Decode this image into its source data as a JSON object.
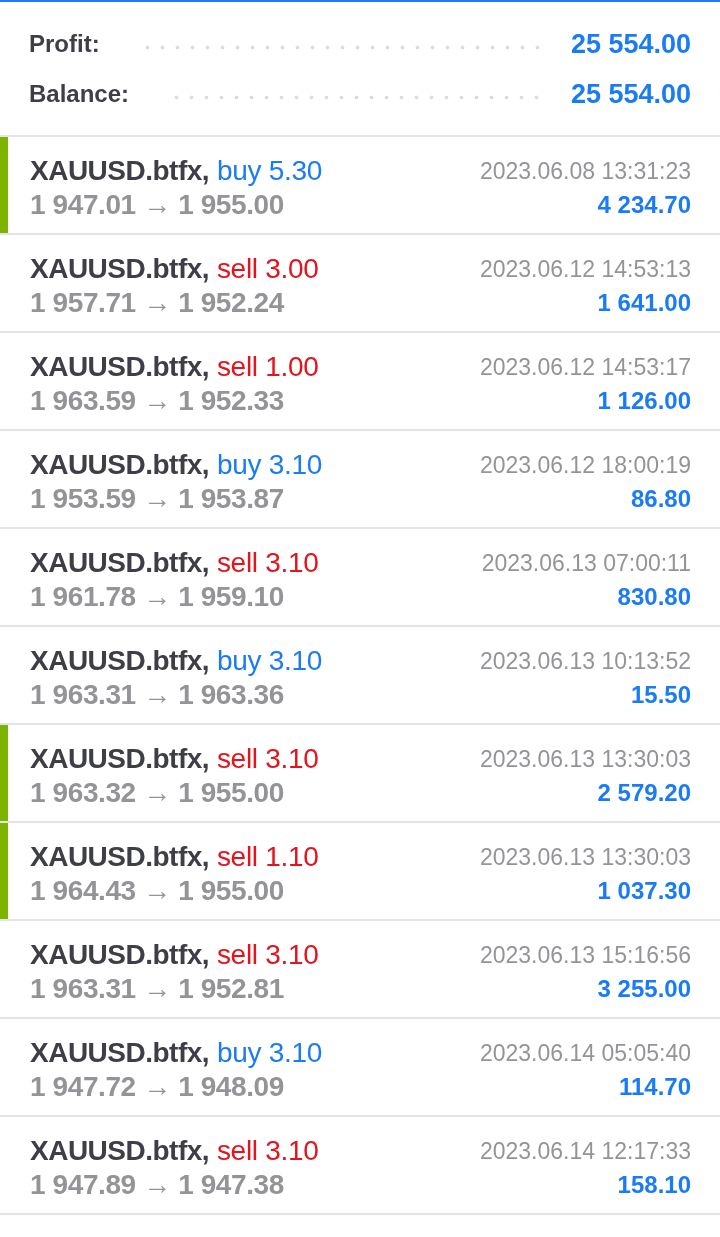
{
  "summary": [
    {
      "label": "Profit:",
      "value": "25 554.00"
    },
    {
      "label": "Balance:",
      "value": "25 554.00"
    }
  ],
  "trades": [
    {
      "symbol": "XAUUSD.btfx,",
      "order": {
        "kind": "buy",
        "text": "buy 5.30"
      },
      "prices": "1 947.01 → 1 955.00",
      "time": "2023.06.08 13:31:23",
      "profit": "4 234.70",
      "highlighted": true
    },
    {
      "symbol": "XAUUSD.btfx,",
      "order": {
        "kind": "sell",
        "text": "sell 3.00"
      },
      "prices": "1 957.71 → 1 952.24",
      "time": "2023.06.12 14:53:13",
      "profit": "1 641.00",
      "highlighted": false
    },
    {
      "symbol": "XAUUSD.btfx,",
      "order": {
        "kind": "sell",
        "text": "sell 1.00"
      },
      "prices": "1 963.59 → 1 952.33",
      "time": "2023.06.12 14:53:17",
      "profit": "1 126.00",
      "highlighted": false
    },
    {
      "symbol": "XAUUSD.btfx,",
      "order": {
        "kind": "buy",
        "text": "buy 3.10"
      },
      "prices": "1 953.59 → 1 953.87",
      "time": "2023.06.12 18:00:19",
      "profit": "86.80",
      "highlighted": false
    },
    {
      "symbol": "XAUUSD.btfx,",
      "order": {
        "kind": "sell",
        "text": "sell 3.10"
      },
      "prices": "1 961.78 → 1 959.10",
      "time": "2023.06.13 07:00:11",
      "profit": "830.80",
      "highlighted": false
    },
    {
      "symbol": "XAUUSD.btfx,",
      "order": {
        "kind": "buy",
        "text": "buy 3.10"
      },
      "prices": "1 963.31 → 1 963.36",
      "time": "2023.06.13 10:13:52",
      "profit": "15.50",
      "highlighted": false
    },
    {
      "symbol": "XAUUSD.btfx,",
      "order": {
        "kind": "sell",
        "text": "sell 3.10"
      },
      "prices": "1 963.32 → 1 955.00",
      "time": "2023.06.13 13:30:03",
      "profit": "2 579.20",
      "highlighted": true
    },
    {
      "symbol": "XAUUSD.btfx,",
      "order": {
        "kind": "sell",
        "text": "sell 1.10"
      },
      "prices": "1 964.43 → 1 955.00",
      "time": "2023.06.13 13:30:03",
      "profit": "1 037.30",
      "highlighted": true
    },
    {
      "symbol": "XAUUSD.btfx,",
      "order": {
        "kind": "sell",
        "text": "sell 3.10"
      },
      "prices": "1 963.31 → 1 952.81",
      "time": "2023.06.13 15:16:56",
      "profit": "3 255.00",
      "highlighted": false
    },
    {
      "symbol": "XAUUSD.btfx,",
      "order": {
        "kind": "buy",
        "text": "buy 3.10"
      },
      "prices": "1 947.72 → 1 948.09",
      "time": "2023.06.14 05:05:40",
      "profit": "114.70",
      "highlighted": false
    },
    {
      "symbol": "XAUUSD.btfx,",
      "order": {
        "kind": "sell",
        "text": "sell 3.10"
      },
      "prices": "1 947.89 → 1 947.38",
      "time": "2023.06.14 12:17:33",
      "profit": "158.10",
      "highlighted": false
    }
  ]
}
